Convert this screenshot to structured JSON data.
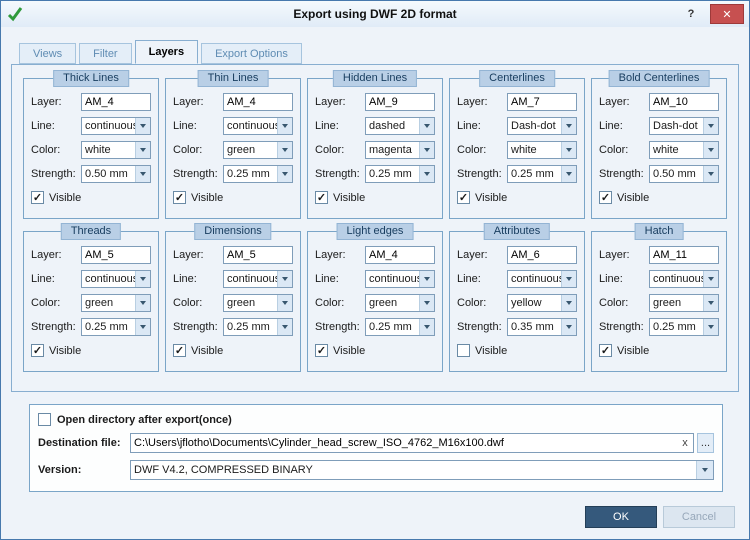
{
  "window": {
    "title": "Export using DWF 2D format",
    "help_label": "?",
    "close_label": "✕"
  },
  "tabs": [
    {
      "label": "Views",
      "active": false
    },
    {
      "label": "Filter",
      "active": false
    },
    {
      "label": "Layers",
      "active": true
    },
    {
      "label": "Export Options",
      "active": false
    }
  ],
  "field_labels": {
    "layer": "Layer:",
    "line": "Line:",
    "color": "Color:",
    "strength": "Strength:",
    "visible": "Visible"
  },
  "groups": [
    {
      "title": "Thick Lines",
      "layer": "AM_4",
      "line": "continuous",
      "color": "white",
      "strength": "0.50 mm",
      "visible": true
    },
    {
      "title": "Thin Lines",
      "layer": "AM_4",
      "line": "continuous",
      "color": "green",
      "strength": "0.25 mm",
      "visible": true
    },
    {
      "title": "Hidden Lines",
      "layer": "AM_9",
      "line": "dashed",
      "color": "magenta",
      "strength": "0.25 mm",
      "visible": true
    },
    {
      "title": "Centerlines",
      "layer": "AM_7",
      "line": "Dash-dot",
      "color": "white",
      "strength": "0.25 mm",
      "visible": true
    },
    {
      "title": "Bold Centerlines",
      "layer": "AM_10",
      "line": "Dash-dot",
      "color": "white",
      "strength": "0.50 mm",
      "visible": true
    },
    {
      "title": "Threads",
      "layer": "AM_5",
      "line": "continuous",
      "color": "green",
      "strength": "0.25 mm",
      "visible": true
    },
    {
      "title": "Dimensions",
      "layer": "AM_5",
      "line": "continuous",
      "color": "green",
      "strength": "0.25 mm",
      "visible": true
    },
    {
      "title": "Light edges",
      "layer": "AM_4",
      "line": "continuous",
      "color": "green",
      "strength": "0.25 mm",
      "visible": true
    },
    {
      "title": "Attributes",
      "layer": "AM_6",
      "line": "continuous",
      "color": "yellow",
      "strength": "0.35 mm",
      "visible": false
    },
    {
      "title": "Hatch",
      "layer": "AM_11",
      "line": "continuous",
      "color": "green",
      "strength": "0.25 mm",
      "visible": true
    }
  ],
  "footer": {
    "open_dir_label": "Open directory after export(once)",
    "open_dir_checked": false,
    "destination_label": "Destination file:",
    "destination_value": "C:\\Users\\jflotho\\Documents\\Cylinder_head_screw_ISO_4762_M16x100.dwf",
    "clear_label": "x",
    "browse_label": "...",
    "version_label": "Version:",
    "version_value": "DWF V4.2, COMPRESSED BINARY"
  },
  "actions": {
    "ok": "OK",
    "cancel": "Cancel"
  }
}
